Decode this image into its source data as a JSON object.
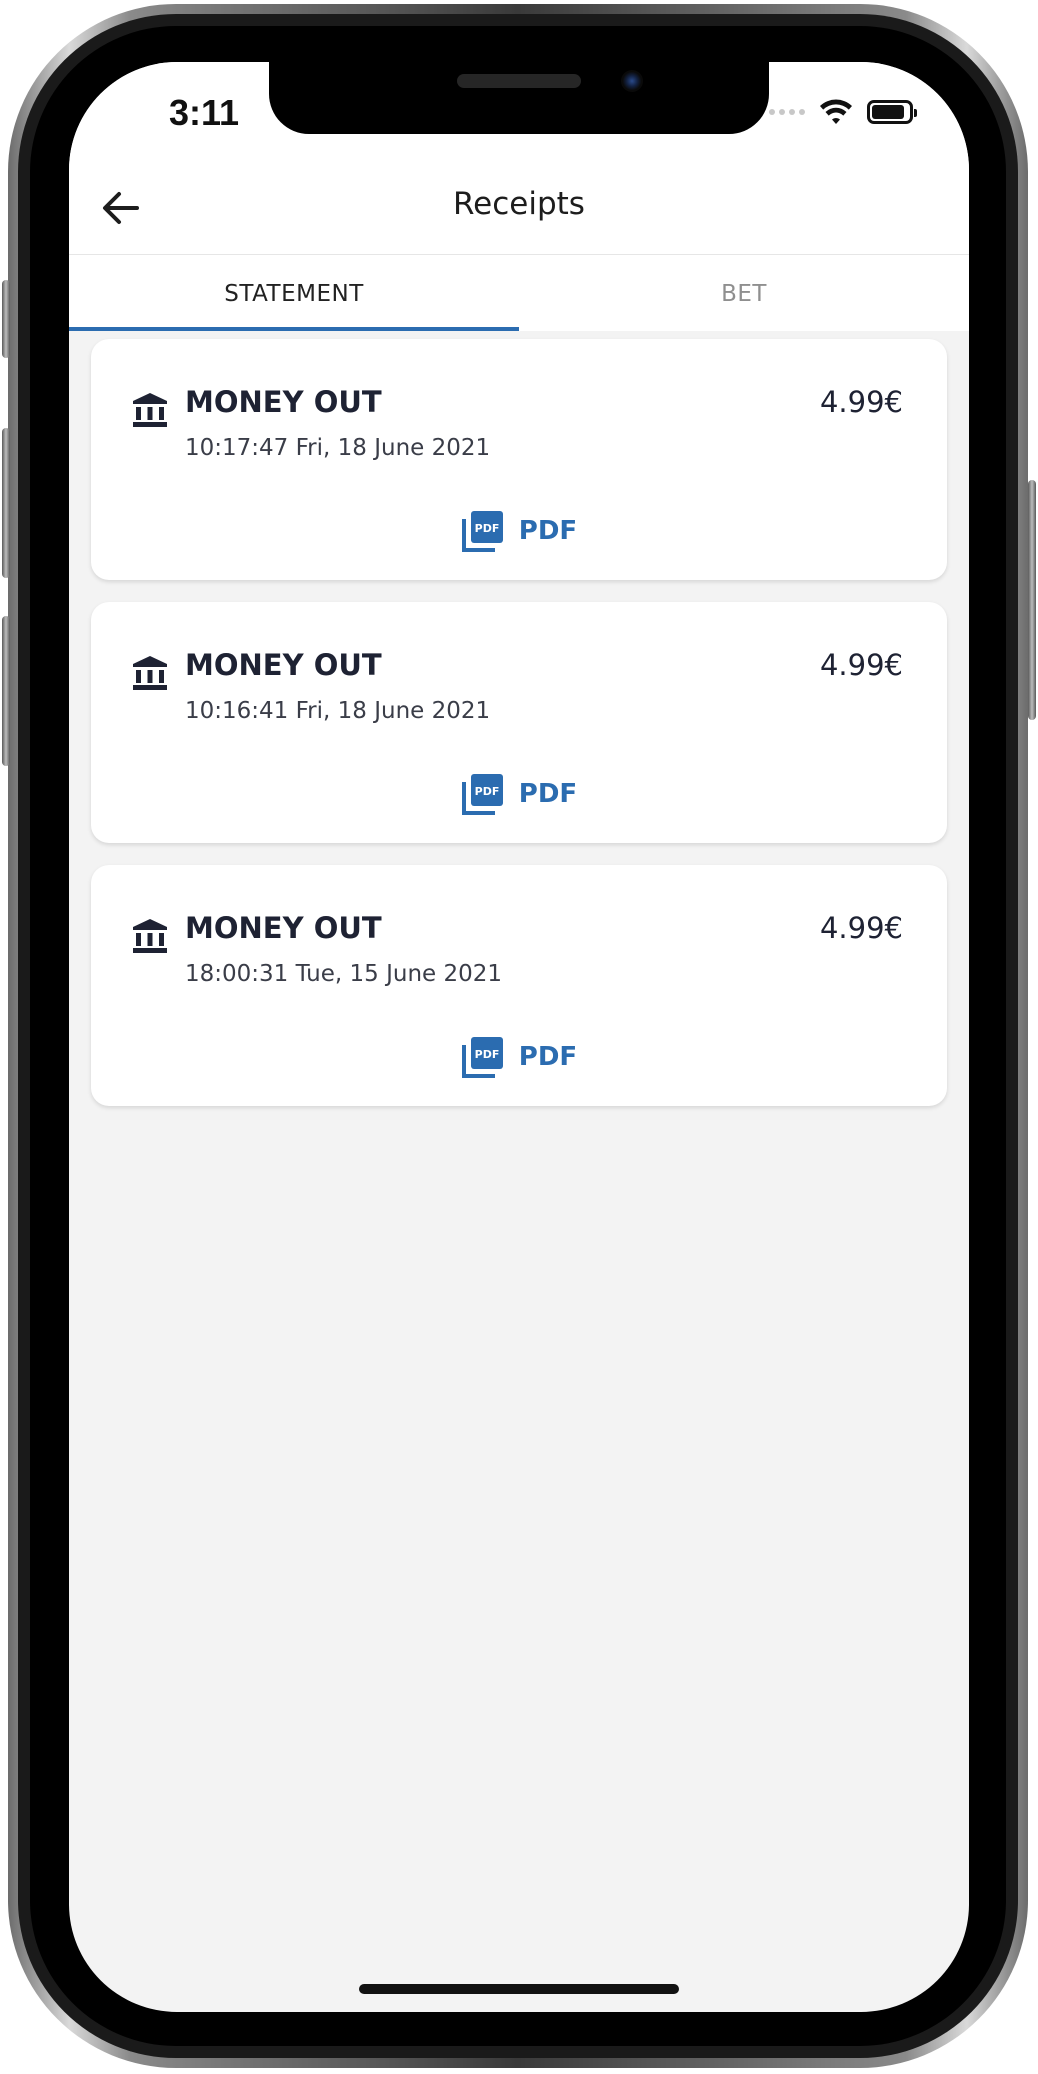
{
  "status_bar": {
    "time": "3:11",
    "battery_level": 0.9
  },
  "header": {
    "title": "Receipts",
    "back_icon": "arrow-left-icon"
  },
  "tabs": [
    {
      "label": "STATEMENT",
      "active": true
    },
    {
      "label": "BET",
      "active": false
    }
  ],
  "receipts": [
    {
      "type": "MONEY OUT",
      "datetime": "10:17:47 Fri, 18 June 2021",
      "amount": "4.99€",
      "pdf_label": "PDF"
    },
    {
      "type": "MONEY OUT",
      "datetime": "10:16:41 Fri, 18 June 2021",
      "amount": "4.99€",
      "pdf_label": "PDF"
    },
    {
      "type": "MONEY OUT",
      "datetime": "18:00:31 Tue, 15 June 2021",
      "amount": "4.99€",
      "pdf_label": "PDF"
    }
  ],
  "colors": {
    "accent": "#2b6cb0",
    "text_primary": "#1e2233",
    "background": "#f3f3f3"
  },
  "icons": {
    "receipt_type": "bank-icon",
    "document": "pdf-icon"
  }
}
